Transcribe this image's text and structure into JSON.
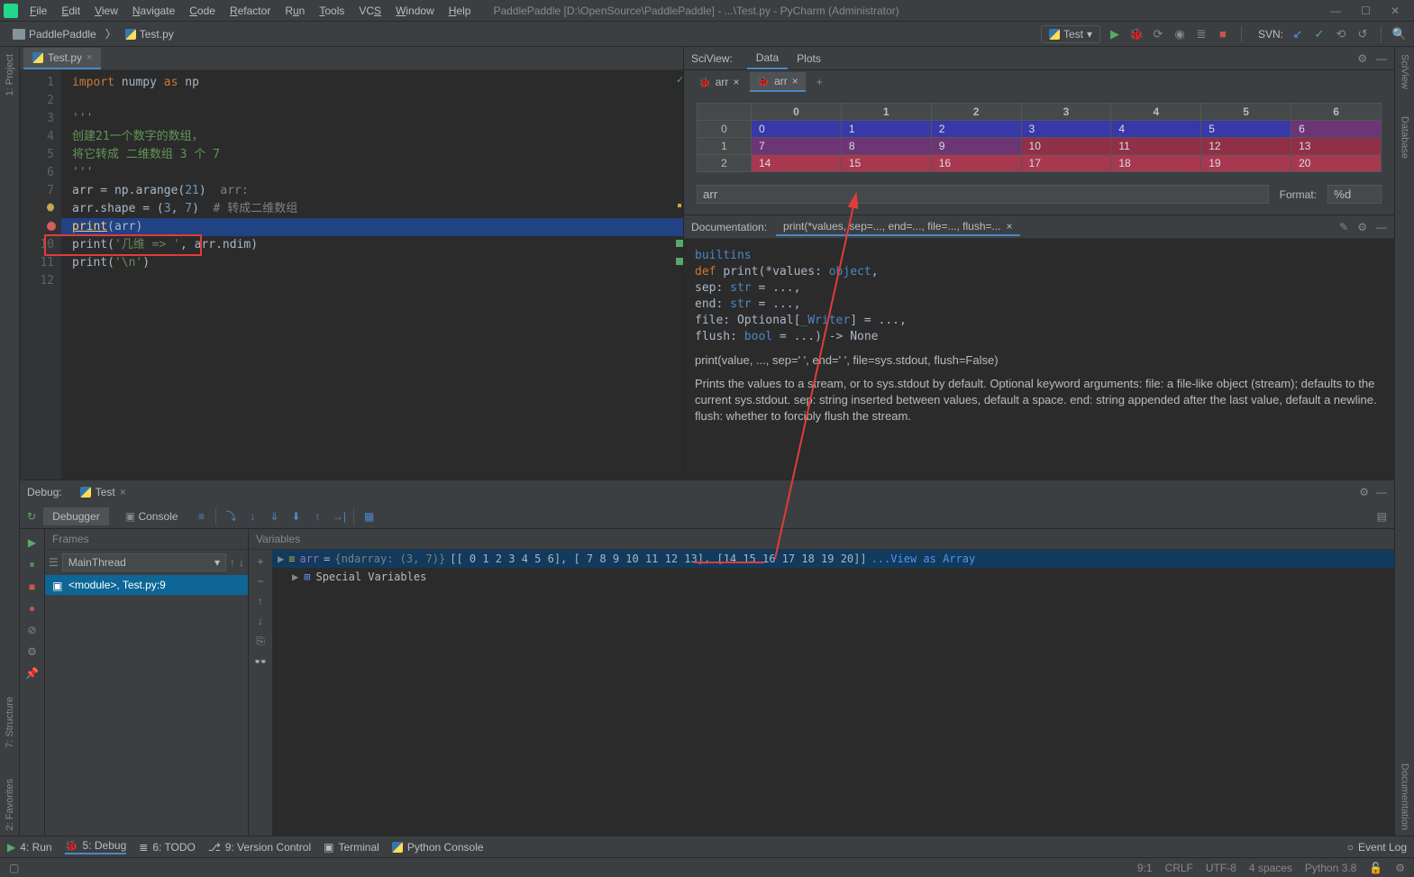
{
  "window": {
    "title": "PaddlePaddle [D:\\OpenSource\\PaddlePaddle] - ...\\Test.py - PyCharm (Administrator)"
  },
  "menu": [
    "File",
    "Edit",
    "View",
    "Navigate",
    "Code",
    "Refactor",
    "Run",
    "Tools",
    "VCS",
    "Window",
    "Help"
  ],
  "breadcrumb": {
    "project": "PaddlePaddle",
    "file": "Test.py"
  },
  "runConfig": "Test",
  "vcs_label": "SVN:",
  "editor": {
    "tab": "Test.py",
    "lines": {
      "l1a": "import",
      "l1b": " numpy ",
      "l1c": "as",
      "l1d": " np",
      "l3": "'''",
      "l4": "创建21一个数字的数组，",
      "l5a": "将它转成 二维数组 ",
      "l5b": "3 ",
      "l5c": "个 ",
      "l5d": "7",
      "l6": "'''",
      "l7a": "arr = np.arange(",
      "l7b": "21",
      "l7c": ")  ",
      "l7d": "arr:",
      "l8a": "arr.shape = (",
      "l8b": "3",
      "l8c": ", ",
      "l8d": "7",
      "l8e": ")  ",
      "l8f": "# 转成二维数组",
      "l9a": "print",
      "l9b": "(arr)",
      "l10a": "print(",
      "l10b": "'几维 => '",
      "l10c": ", arr.ndim)",
      "l11a": "print(",
      "l11b": "'\\n'",
      "l11c": ")"
    }
  },
  "sciview": {
    "tabs": [
      "Data",
      "Plots"
    ],
    "dataTabs": [
      "arr",
      "arr"
    ],
    "cols": [
      "0",
      "1",
      "2",
      "3",
      "4",
      "5",
      "6"
    ],
    "rows": [
      {
        "h": "0",
        "v": [
          "0",
          "1",
          "2",
          "3",
          "4",
          "5",
          "6"
        ],
        "cls": "c-blue"
      },
      {
        "h": "1",
        "v": [
          "7",
          "8",
          "9",
          "10",
          "11",
          "12",
          "13"
        ],
        "cls": "c-purple"
      },
      {
        "h": "2",
        "v": [
          "14",
          "15",
          "16",
          "17",
          "18",
          "19",
          "20"
        ],
        "cls": "c-red"
      }
    ],
    "arrName": "arr",
    "formatLabel": "Format:",
    "formatValue": "%d"
  },
  "doc": {
    "title": "Documentation:",
    "sig": "print(*values, sep=..., end=..., file=..., flush=...",
    "line1": "builtins",
    "body_prefix": "def ",
    "body_name": "print",
    "body_args": "(*values: ",
    "body_obj": "object",
    "body_tail1": ",",
    "l2a": "           sep: ",
    "l2b": "str",
    "l2c": " = ...,",
    "l3a": "           end: ",
    "l3b": "str",
    "l3c": " = ...,",
    "l4a": "           file: Optional[",
    "l4b": "_Writer",
    "l4c": "] = ...,",
    "l5a": "           flush: ",
    "l5b": "bool",
    "l5c": " = ...) -> None",
    "txt1": "print(value, ..., sep=' ', end=' ', file=sys.stdout, flush=False)",
    "txt2": "Prints the values to a stream, or to sys.stdout by default. Optional keyword arguments: file: a file-like object (stream); defaults to the current sys.stdout. sep: string inserted between values, default a space. end: string appended after the last value, default a newline. flush: whether to forcibly flush the stream."
  },
  "debug": {
    "title": "Debug:",
    "config": "Test",
    "tabDebugger": "Debugger",
    "tabConsole": "Console",
    "framesTitle": "Frames",
    "varsTitle": "Variables",
    "thread": "MainThread",
    "frame": "<module>, Test.py:9",
    "varName": "arr",
    "varEq": " = ",
    "varType": "{ndarray: (3, 7)}",
    "varVal": " [[ 0  1  2  3  4  5  6], [ 7  8  9 10 11 12 13], [14 15 16 17 18 19 20]]",
    "viewArray": "...View as Array",
    "special": "Special Variables"
  },
  "bottomButtons": {
    "run": "4: Run",
    "debug": "5: Debug",
    "todo": "6: TODO",
    "vc": "9: Version Control",
    "term": "Terminal",
    "pycon": "Python Console",
    "eventlog": "Event Log"
  },
  "status": {
    "pos": "9:1",
    "crlf": "CRLF",
    "enc": "UTF-8",
    "indent": "4 spaces",
    "py": "Python 3.8"
  },
  "leftGutter": {
    "project": "1: Project"
  },
  "rightGutter": {
    "sciview": "SciView",
    "database": "Database",
    "doc": "Documentation"
  },
  "leftStripBottom": {
    "fav": "2: Favorites",
    "struct": "7: Structure"
  }
}
